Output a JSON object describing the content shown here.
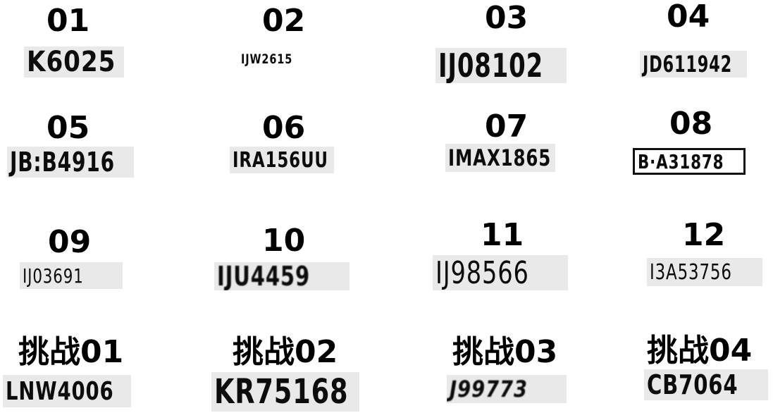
{
  "title": "",
  "samples": [
    {
      "label": "01",
      "plate": "K6025"
    },
    {
      "label": "02",
      "plate": "IJW2615"
    },
    {
      "label": "03",
      "plate": "IJ08102"
    },
    {
      "label": "04",
      "plate": "JD611942"
    },
    {
      "label": "05",
      "plate": "JB:B4916"
    },
    {
      "label": "06",
      "plate": "IRA156UU"
    },
    {
      "label": "07",
      "plate": "IMAX1865"
    },
    {
      "label": "08",
      "plate": "B·A31878"
    },
    {
      "label": "09",
      "plate": "IJ03691"
    },
    {
      "label": "10",
      "plate": "IJU4459"
    },
    {
      "label": "11",
      "plate": "IJ98566"
    },
    {
      "label": "12",
      "plate": "I3A53756"
    },
    {
      "label": "挑战01",
      "plate": "LNW4006"
    },
    {
      "label": "挑战02",
      "plate": "KR75168"
    },
    {
      "label": "挑战03",
      "plate": "J99773"
    },
    {
      "label": "挑战04",
      "plate": "CB7064"
    }
  ]
}
